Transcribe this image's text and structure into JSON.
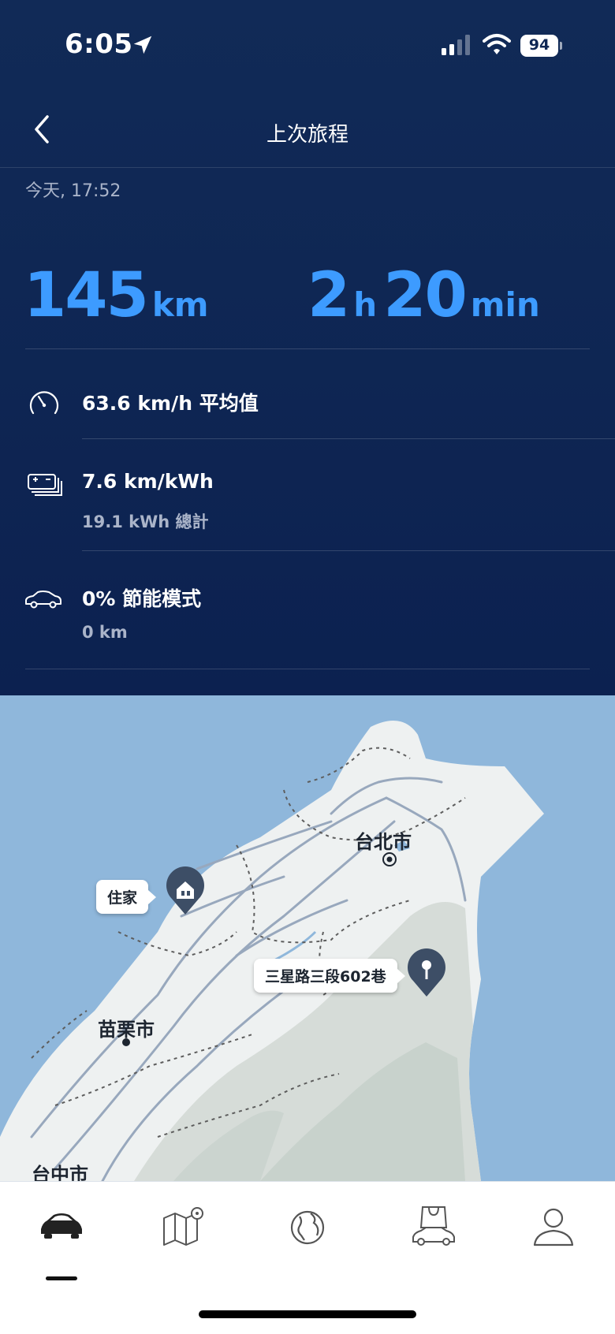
{
  "status_bar": {
    "time": "6:05",
    "battery": "94",
    "icons": [
      "location-arrow-icon",
      "signal-icon",
      "wifi-icon",
      "battery-icon"
    ]
  },
  "header": {
    "title": "上次旅程",
    "back_icon": "chevron-left-icon"
  },
  "trip": {
    "date": "今天, 17:52",
    "distance": {
      "value": "145",
      "unit": "km"
    },
    "duration": {
      "hours": "2",
      "hours_unit": "h",
      "minutes": "20",
      "minutes_unit": "min"
    }
  },
  "stats": [
    {
      "icon": "speedometer-icon",
      "main": "63.6 km/h 平均值",
      "sub": ""
    },
    {
      "icon": "battery-consumption-icon",
      "main": "7.6 km/kWh",
      "sub": "19.1 kWh 總計"
    },
    {
      "icon": "car-eco-icon",
      "main": "0% 節能模式",
      "sub": "0 km"
    }
  ],
  "map": {
    "city_labels": [
      "台北市",
      "苗栗市",
      "台中市"
    ],
    "start_label": "住家",
    "end_label": "三星路三段602巷",
    "colors": {
      "water": "#8fb7db",
      "land": "#eef1f1",
      "terrain": "#d6dcd8",
      "road": "#98a8bd",
      "pin": "#3d4e66"
    }
  },
  "tab_bar": {
    "tabs": [
      "car-icon",
      "map-pin-icon",
      "globe-icon",
      "car-shop-icon",
      "profile-icon"
    ],
    "active_tab": "car-icon"
  },
  "colors": {
    "header_bg": "#0f2754",
    "accent": "#3d9bff",
    "secondary_text": "#aab4c9"
  }
}
